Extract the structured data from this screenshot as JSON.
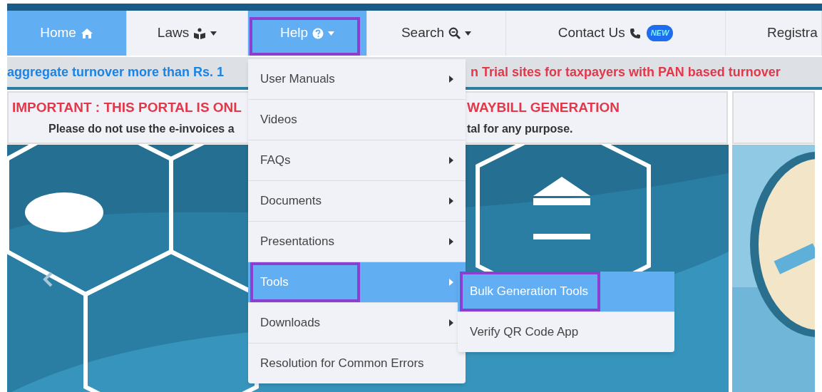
{
  "nav": {
    "items": [
      {
        "label": "Home",
        "selected": true,
        "annotated": false
      },
      {
        "label": "Laws",
        "selected": false,
        "annotated": false
      },
      {
        "label": "Help",
        "selected": true,
        "annotated": true
      },
      {
        "label": "Search",
        "selected": false,
        "annotated": false
      },
      {
        "label": "Contact Us",
        "badge": "NEW",
        "selected": false,
        "annotated": false
      },
      {
        "label": "Registra",
        "selected": false,
        "annotated": false
      }
    ]
  },
  "ticker": {
    "segments": [
      {
        "text": "aggregate turnover more than Rs. 1",
        "color": "#1a84e6"
      },
      {
        "text": "n Trial sites for taxpayers with PAN based turnover",
        "color": "#e2384a"
      }
    ]
  },
  "notice": {
    "title_parts": [
      "IMPORTANT : THIS PORTAL IS ONL",
      "WAYBILL GENERATION"
    ],
    "body_parts": [
      "Please do not use the e-invoices a",
      "tal for any purpose."
    ]
  },
  "menu": {
    "items": [
      {
        "label": "User Manuals",
        "has_submenu": true,
        "selected": false,
        "annotated": false
      },
      {
        "label": "Videos",
        "has_submenu": false,
        "selected": false,
        "annotated": false
      },
      {
        "label": "FAQs",
        "has_submenu": true,
        "selected": false,
        "annotated": false
      },
      {
        "label": "Documents",
        "has_submenu": true,
        "selected": false,
        "annotated": false
      },
      {
        "label": "Presentations",
        "has_submenu": true,
        "selected": false,
        "annotated": false
      },
      {
        "label": "Tools",
        "has_submenu": true,
        "selected": true,
        "annotated": true
      },
      {
        "label": "Downloads",
        "has_submenu": true,
        "selected": false,
        "annotated": false
      },
      {
        "label": "Resolution for Common Errors",
        "has_submenu": false,
        "selected": false,
        "annotated": false
      }
    ]
  },
  "submenu": {
    "items": [
      {
        "label": "Bulk Generation Tools",
        "selected": true,
        "annotated": true
      },
      {
        "label": "Verify QR Code App",
        "selected": false,
        "annotated": false
      }
    ]
  }
}
